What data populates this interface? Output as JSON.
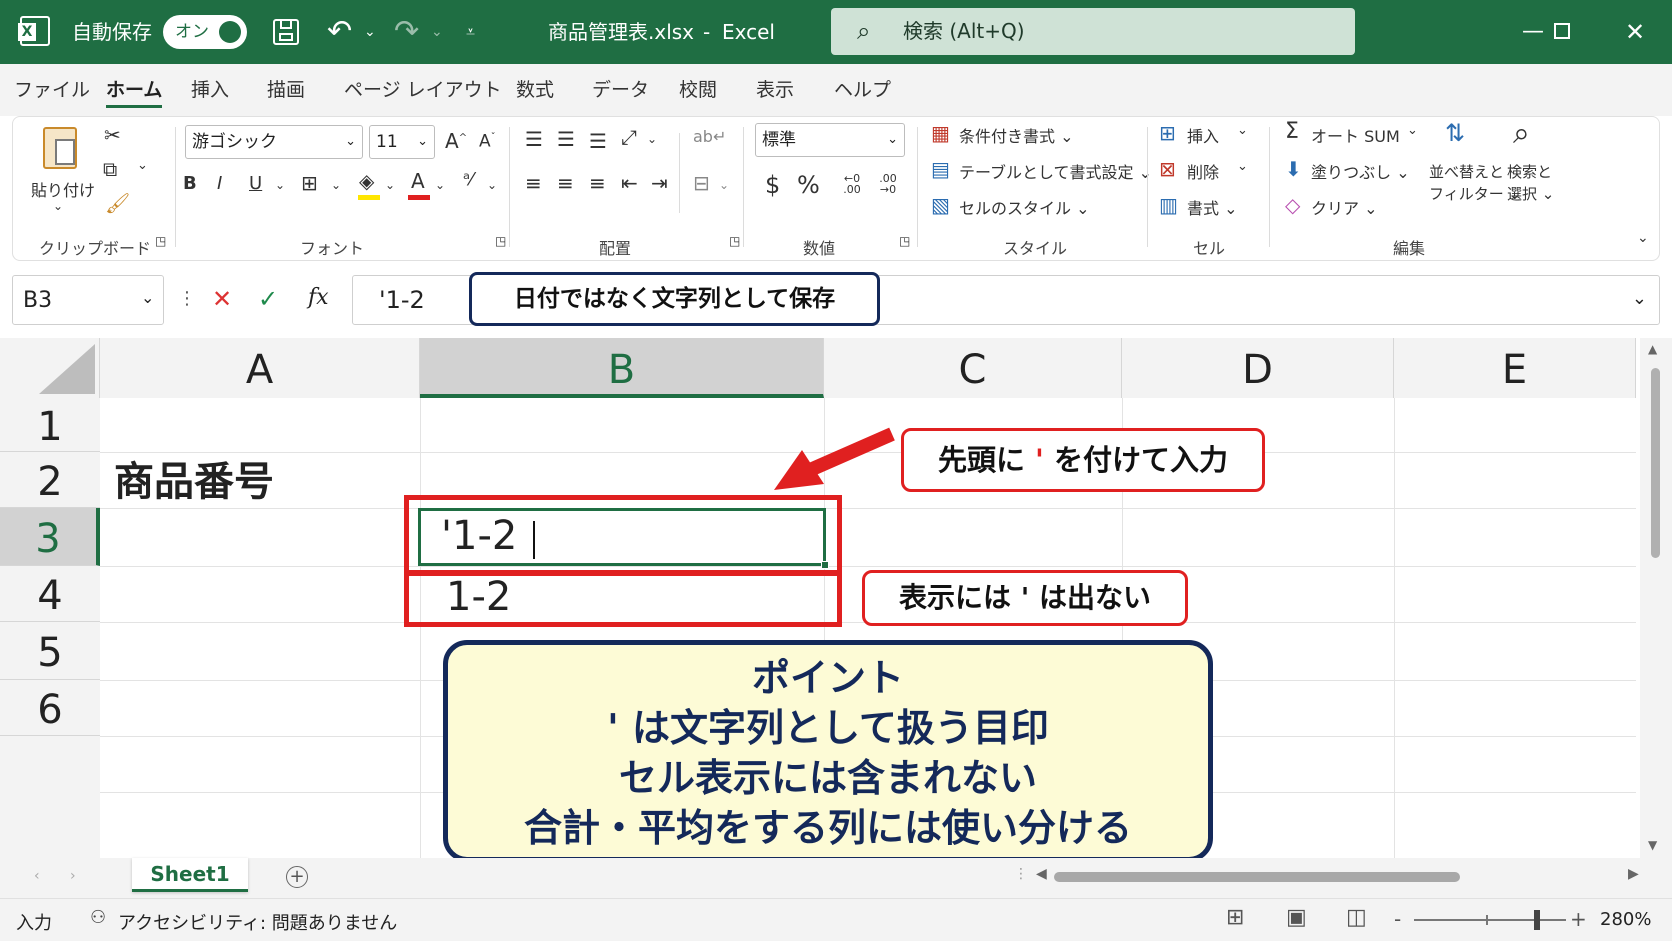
{
  "titlebar": {
    "autosave_label": "自動保存",
    "autosave_state": "オン",
    "filename": "商品管理表.xlsx",
    "separator": "-",
    "app_name": "Excel",
    "search_placeholder": "検索 (Alt+Q)",
    "bg_color": "#1f6e43"
  },
  "menu": {
    "items": [
      "ファイル",
      "ホーム",
      "挿入",
      "描画",
      "ページ レイアウト",
      "数式",
      "データ",
      "校閲",
      "表示",
      "ヘルプ"
    ],
    "active": "ホーム"
  },
  "ribbon": {
    "clipboard": {
      "paste": "貼り付け",
      "group": "クリップボード"
    },
    "font": {
      "name": "游ゴシック",
      "size": "11",
      "bold": "B",
      "italic": "I",
      "underline": "U",
      "font_color": "A",
      "grow": "A",
      "shrink": "A",
      "group": "フォント"
    },
    "alignment": {
      "group": "配置"
    },
    "number": {
      "format": "標準",
      "currency": "$",
      "percent": "%",
      "inc_decimal": "←0 .00",
      "dec_decimal": ".00 →0",
      "group": "数値"
    },
    "styles": {
      "conditional": "条件付き書式",
      "as_table": "テーブルとして書式設定",
      "cell_styles": "セルのスタイル",
      "group": "スタイル"
    },
    "cells": {
      "insert": "挿入",
      "delete": "削除",
      "format": "書式",
      "group": "セル"
    },
    "editing": {
      "autosum": "オート SUM",
      "fill": "塗りつぶし",
      "clear": "クリア",
      "sort_filter_1": "並べ替えと",
      "sort_filter_2": "フィルター",
      "find_1": "検索と",
      "find_2": "選択",
      "group": "編集"
    }
  },
  "formula_bar": {
    "name_box": "B3",
    "cancel": "✕",
    "enter": "✓",
    "fx": "fx",
    "value": "'1-2",
    "annotation": "日付ではなく文字列として保存"
  },
  "grid": {
    "columns": [
      "A",
      "B",
      "C",
      "D",
      "E"
    ],
    "selected_column": "B",
    "rows": [
      "1",
      "2",
      "3",
      "4",
      "5",
      "6"
    ],
    "selected_row": "3",
    "cells": {
      "A2": "商品番号",
      "B3": "'1-2",
      "B4": "1-2"
    }
  },
  "annotations": {
    "arrow_callout_pre": "先頭に",
    "arrow_callout_mark": "'",
    "arrow_callout_post": "を付けて入力",
    "display_callout": "表示には ' は出ない",
    "point_title": "ポイント",
    "point_line1": "' は文字列として扱う目印",
    "point_line2": "セル表示には含まれない",
    "point_line3": "合計・平均をする列には使い分ける",
    "highlight_color": "#e02020",
    "point_bg": "#fdfbd6",
    "point_border": "#14295a"
  },
  "sheets": {
    "tabs": [
      "Sheet1"
    ],
    "active": "Sheet1",
    "add": "+"
  },
  "status": {
    "mode": "入力",
    "accessibility": "アクセシビリティ: 問題ありません",
    "zoom": "280%",
    "minus": "-",
    "plus": "+"
  }
}
